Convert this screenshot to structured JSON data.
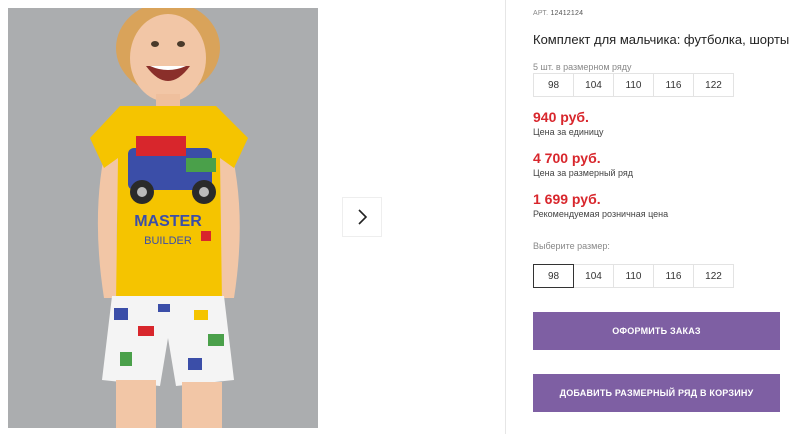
{
  "product": {
    "article_prefix": "АРТ.",
    "article_code": "12412124",
    "title": "Комплект для мальчика: футболка, шорты",
    "size_row_hint": "5 шт. в размерном ряду",
    "size_row": [
      "98",
      "104",
      "110",
      "116",
      "122"
    ]
  },
  "prices": [
    {
      "value": "940 руб.",
      "label": "Цена за единицу"
    },
    {
      "value": "4 700 руб.",
      "label": "Цена за размерный ряд"
    },
    {
      "value": "1 699 руб.",
      "label": "Рекомендуемая розничная цена"
    }
  ],
  "size_picker": {
    "label": "Выберите размер:",
    "options": [
      "98",
      "104",
      "110",
      "116",
      "122"
    ],
    "selected": "98"
  },
  "actions": {
    "order_label": "ОФОРМИТЬ ЗАКАЗ",
    "add_row_label": "ДОБАВИТЬ РАЗМЕРНЫЙ РЯД В КОРЗИНУ"
  },
  "gallery": {
    "next_icon": "chevron-right-icon",
    "tshirt_print_line1": "MASTER",
    "tshirt_print_line2": "BUILDER"
  },
  "colors": {
    "price": "#d8262c",
    "button": "#7e5fa3",
    "photo_bg": "#a9abad",
    "tshirt": "#f5c400"
  }
}
